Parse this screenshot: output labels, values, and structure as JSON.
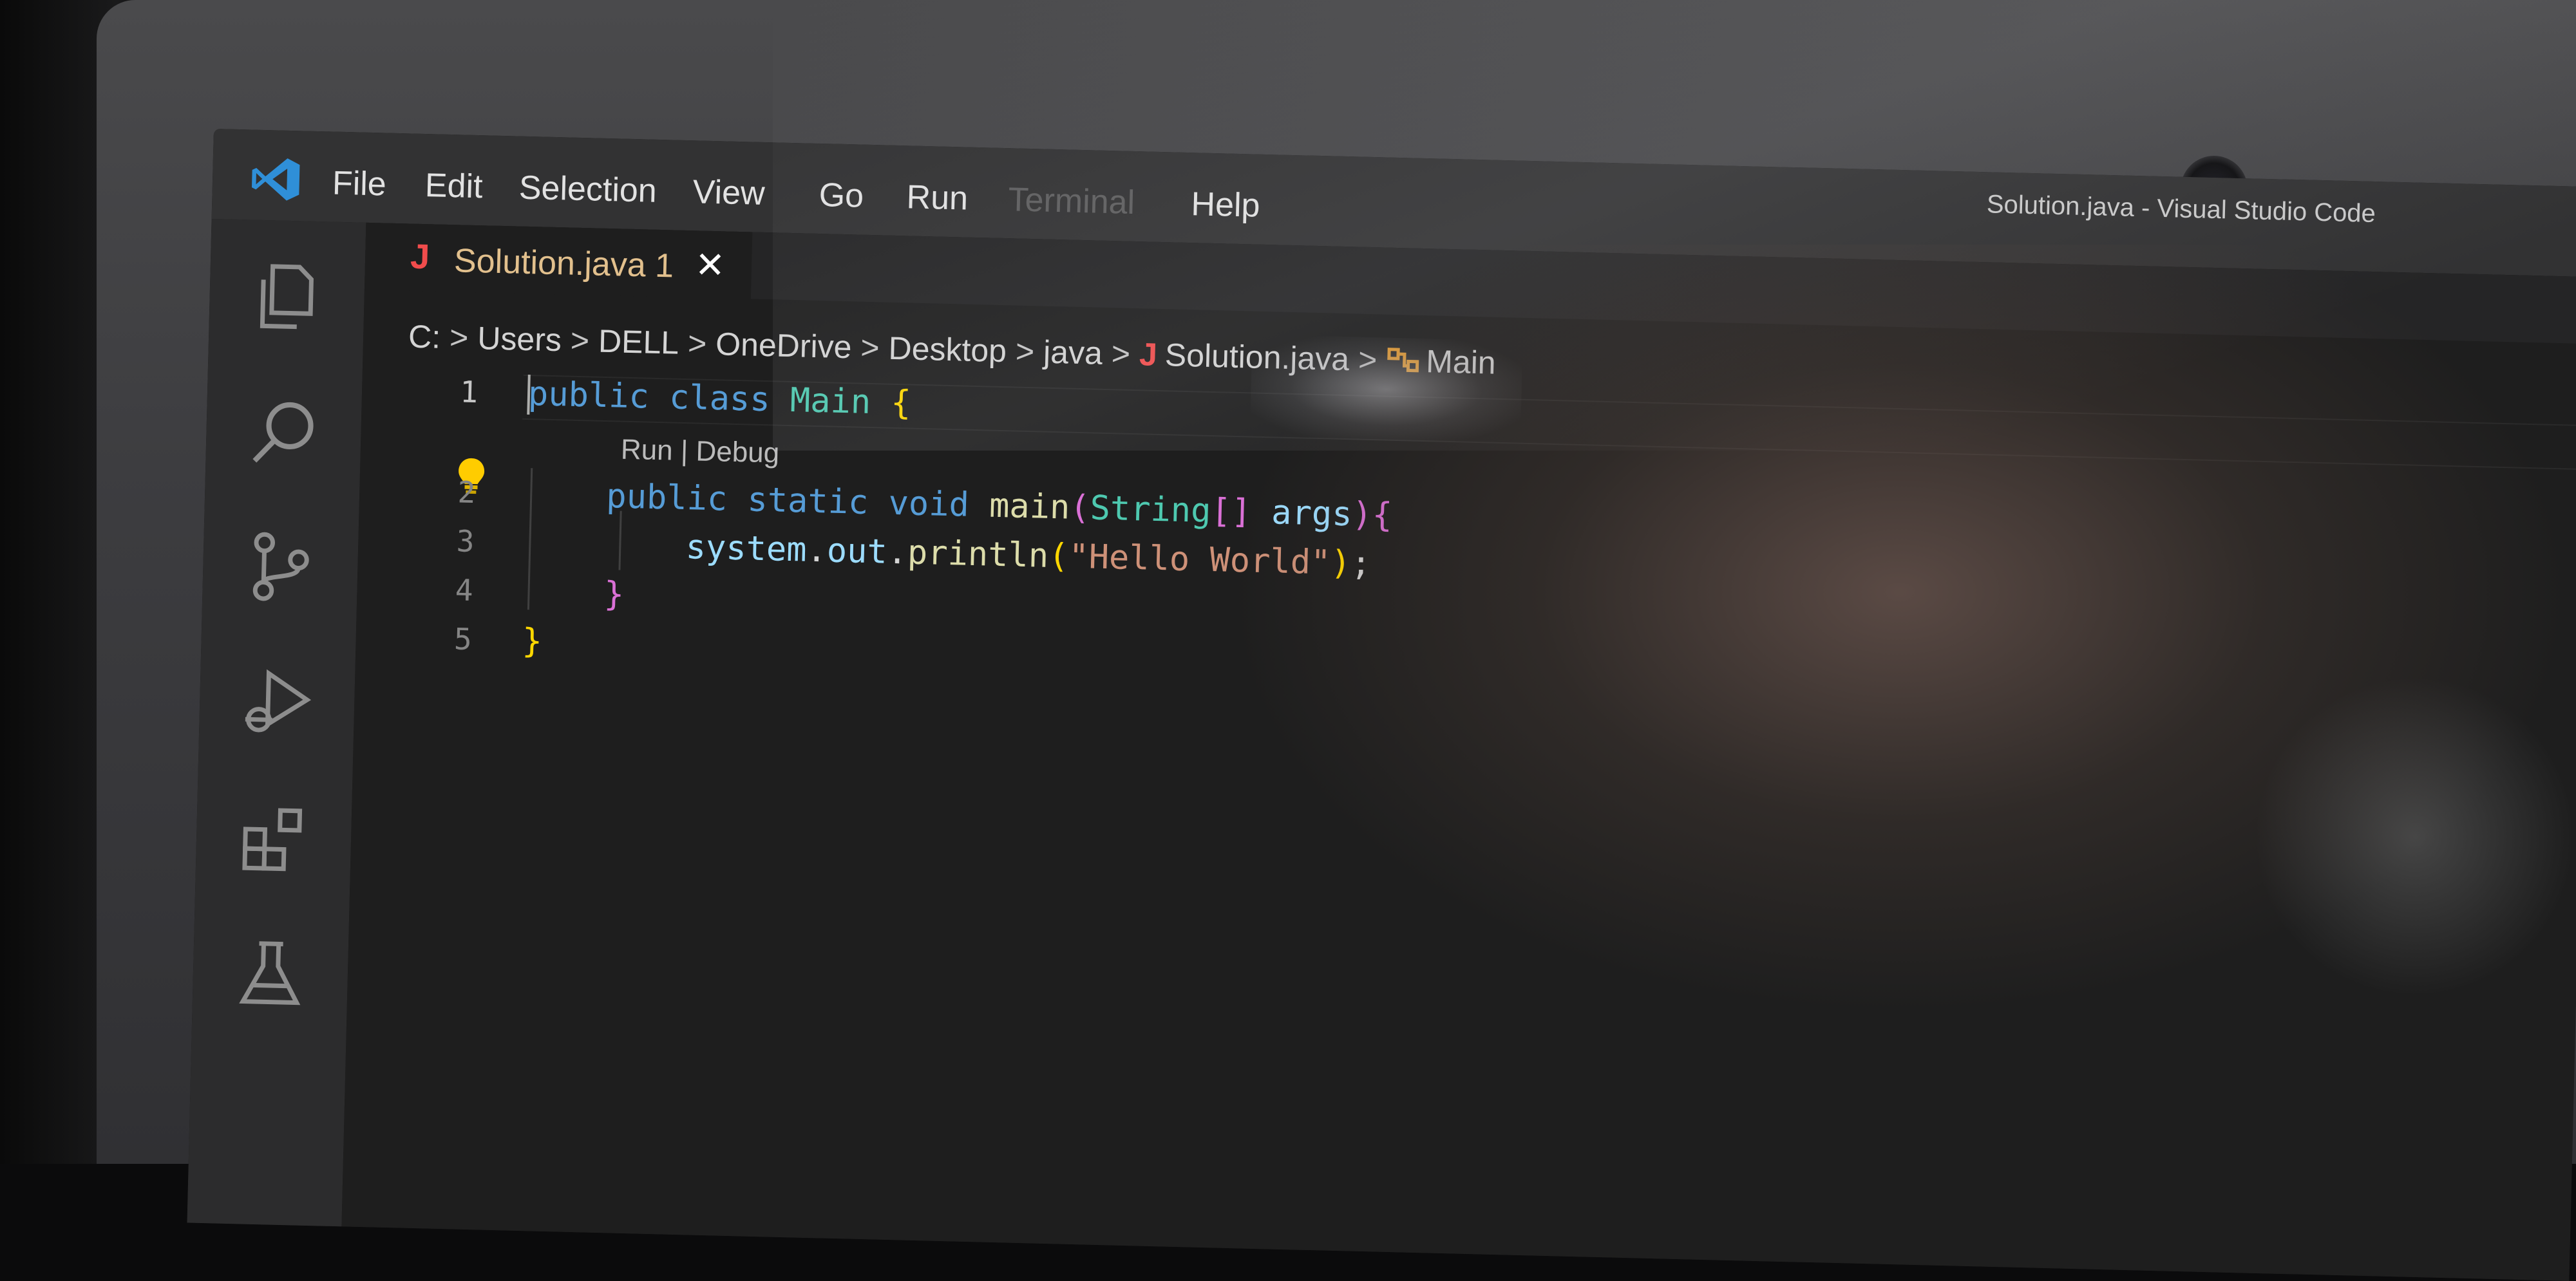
{
  "app": {
    "window_title": "Solution.java - Visual Studio Code",
    "colors": {
      "editor_bg": "#1e1e1e",
      "titlebar_bg": "#323233",
      "activity_bar_bg": "#2c2c2d",
      "accent_blue": "#3b9de0",
      "tab_title_color": "#e2c08d",
      "java_icon_color": "#f14c4c"
    }
  },
  "menu": {
    "items": [
      "File",
      "Edit",
      "Selection",
      "View",
      "Go",
      "Run",
      "Terminal",
      "Help"
    ]
  },
  "activity_bar": {
    "icons": [
      "explorer-icon",
      "search-icon",
      "source-control-icon",
      "run-debug-icon",
      "extensions-icon",
      "testing-icon"
    ]
  },
  "tab": {
    "file_icon": "J",
    "title": "Solution.java 1",
    "close_icon": "✕"
  },
  "breadcrumb": {
    "items": [
      "C:",
      "Users",
      "DELL",
      "OneDrive",
      "Desktop",
      "java"
    ],
    "file_icon": "J",
    "file": "Solution.java",
    "symbol_icon": "class-icon",
    "symbol": "Main",
    "separator": ">"
  },
  "editor": {
    "codelens": "Run | Debug",
    "line_numbers": [
      "1",
      "2",
      "3",
      "4",
      "5"
    ],
    "lines": [
      {
        "tokens": [
          [
            "kw",
            "public"
          ],
          [
            "plain",
            " "
          ],
          [
            "kw",
            "class"
          ],
          [
            "plain",
            " "
          ],
          [
            "cls",
            "Main"
          ],
          [
            "plain",
            " "
          ],
          [
            "br1",
            "{"
          ]
        ]
      },
      {
        "tokens": [
          [
            "plain",
            "    "
          ],
          [
            "kw",
            "public"
          ],
          [
            "plain",
            " "
          ],
          [
            "kw",
            "static"
          ],
          [
            "plain",
            " "
          ],
          [
            "kw",
            "void"
          ],
          [
            "plain",
            " "
          ],
          [
            "fn",
            "main"
          ],
          [
            "br2",
            "("
          ],
          [
            "cls",
            "String"
          ],
          [
            "br2",
            "[]"
          ],
          [
            "plain",
            " "
          ],
          [
            "var",
            "args"
          ],
          [
            "br2",
            ")"
          ],
          [
            "br2",
            "{"
          ]
        ]
      },
      {
        "tokens": [
          [
            "plain",
            "        "
          ],
          [
            "var",
            "system"
          ],
          [
            "plain",
            "."
          ],
          [
            "var",
            "out"
          ],
          [
            "plain",
            "."
          ],
          [
            "fn",
            "println"
          ],
          [
            "br1",
            "("
          ],
          [
            "str",
            "\"Hello World\""
          ],
          [
            "br1",
            ")"
          ],
          [
            "plain",
            ";"
          ]
        ]
      },
      {
        "tokens": [
          [
            "plain",
            "    "
          ],
          [
            "br2",
            "}"
          ]
        ]
      },
      {
        "tokens": [
          [
            "br1",
            "}"
          ]
        ]
      }
    ]
  }
}
